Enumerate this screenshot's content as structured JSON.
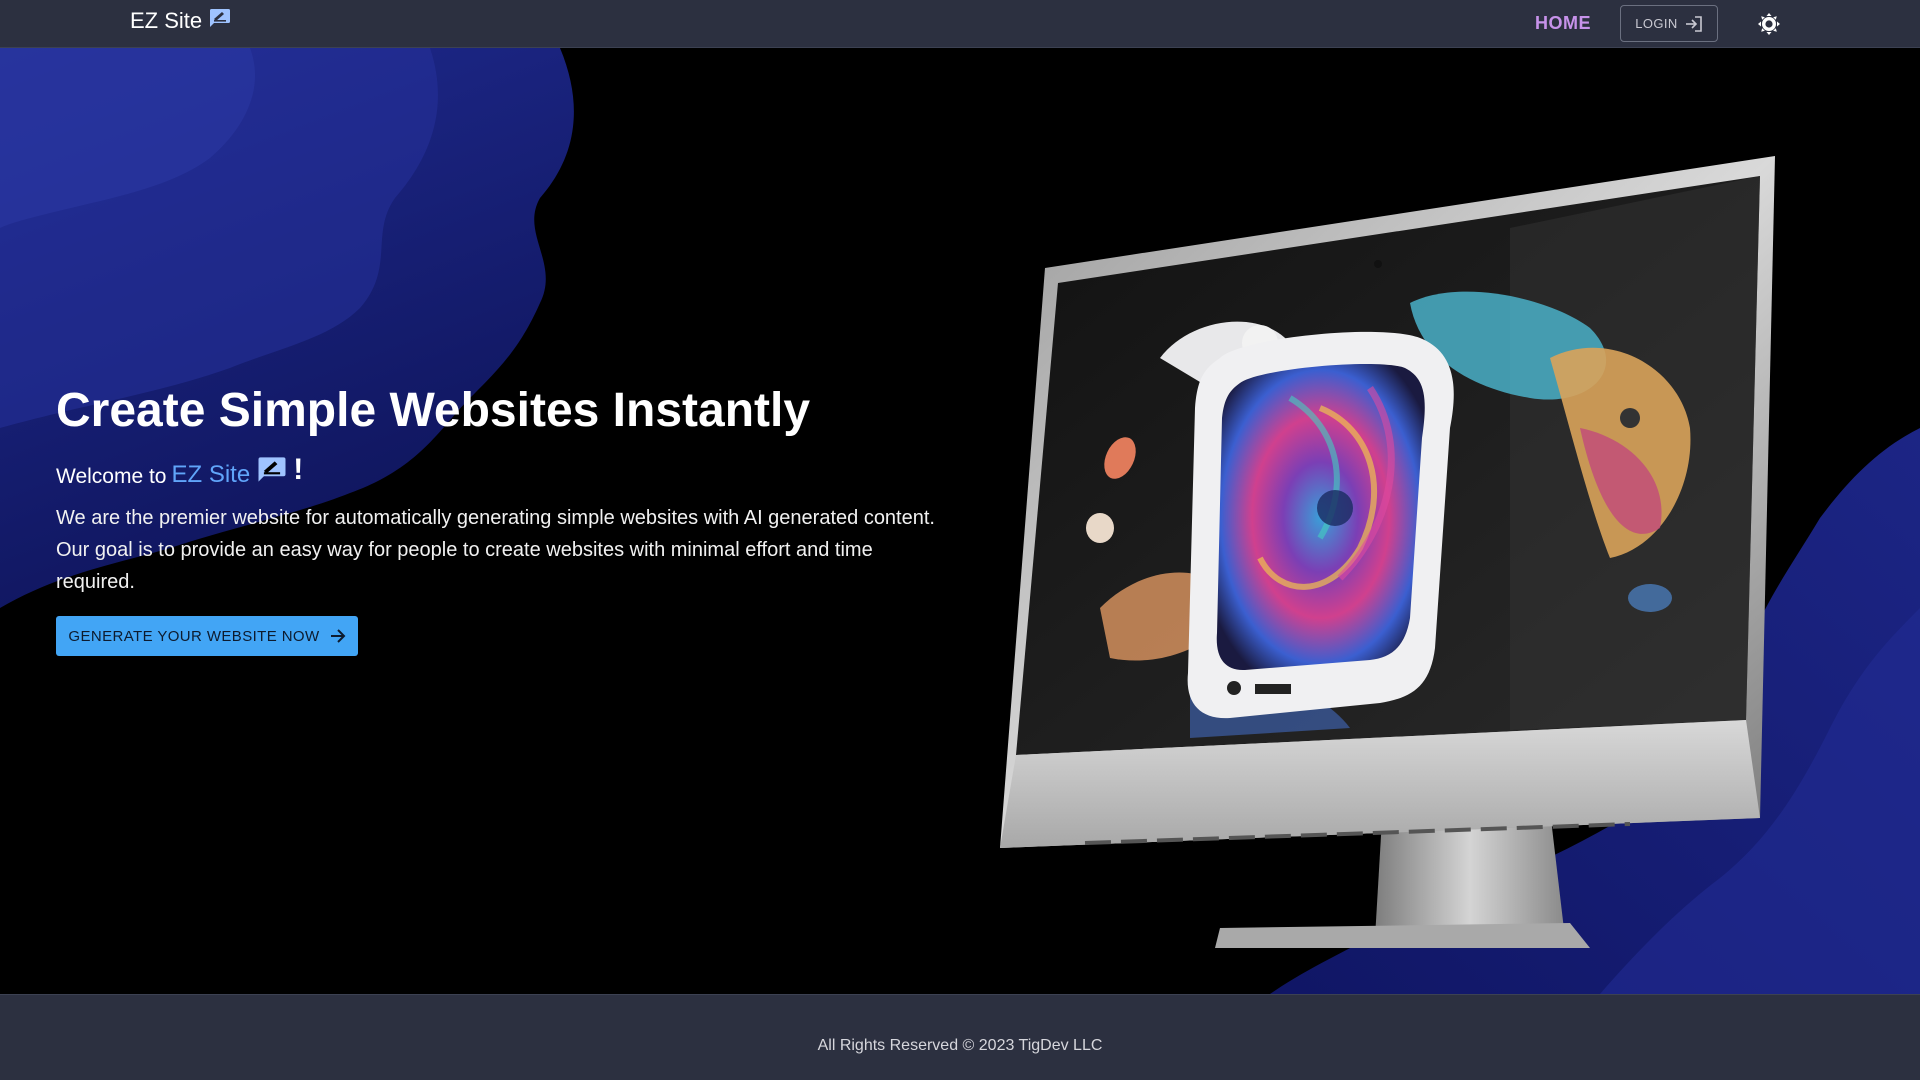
{
  "header": {
    "brand": "EZ Site",
    "brand_icon": "edit-chat-icon",
    "nav_home": "HOME",
    "login_label": "LOGIN",
    "login_icon": "login-icon",
    "theme_icon": "brightness-icon"
  },
  "hero": {
    "title": "Create Simple Websites Instantly",
    "welcome_prefix": "Welcome to",
    "welcome_brand": "EZ Site",
    "welcome_suffix": "!",
    "description": "We are the premier website for automatically generating simple websites with AI generated content. Our goal is to provide an easy way for people to create websites with minimal effort and time required.",
    "cta_label": "GENERATE YOUR WEBSITE NOW",
    "cta_icon": "arrow-right-icon"
  },
  "footer": {
    "text": "All Rights Reserved © 2023 TigDev LLC"
  },
  "colors": {
    "navbar_bg": "#2c3040",
    "home_accent": "#c792ea",
    "brand_accent": "#60a5fa",
    "cta_bg": "#42a5f5",
    "blob_blue": "#1a2480"
  }
}
